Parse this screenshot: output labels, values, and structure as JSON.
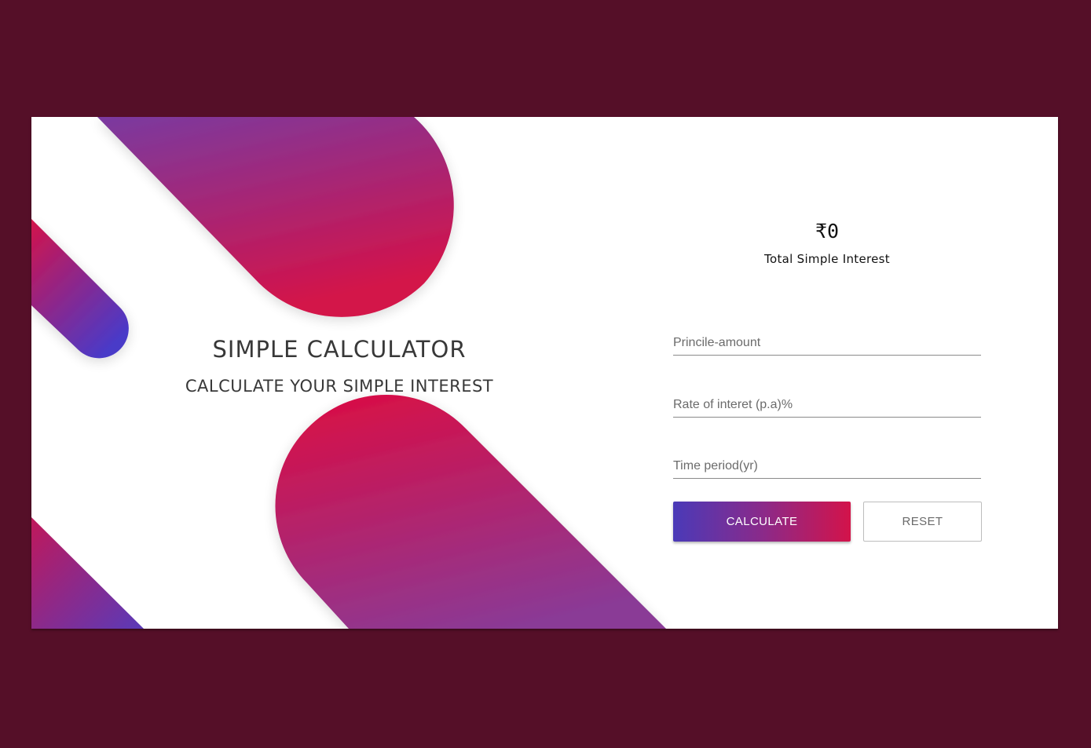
{
  "app": {
    "title": "SIMPLE CALCULATOR",
    "subtitle": "CALCULATE YOUR SIMPLE INTEREST"
  },
  "result": {
    "amount": "₹0",
    "label": "Total Simple Interest"
  },
  "form": {
    "principal_placeholder": "Princile-amount",
    "rate_placeholder": "Rate of interet (p.a)%",
    "time_placeholder": "Time period(yr)",
    "principal_value": "",
    "rate_value": "",
    "time_value": ""
  },
  "buttons": {
    "calculate_label": "CALCULATE",
    "reset_label": "RESET"
  },
  "colors": {
    "page_background": "#550f28",
    "card_background": "#ffffff",
    "gradient_start": "#4a3ab8",
    "gradient_end": "#d3134a"
  }
}
